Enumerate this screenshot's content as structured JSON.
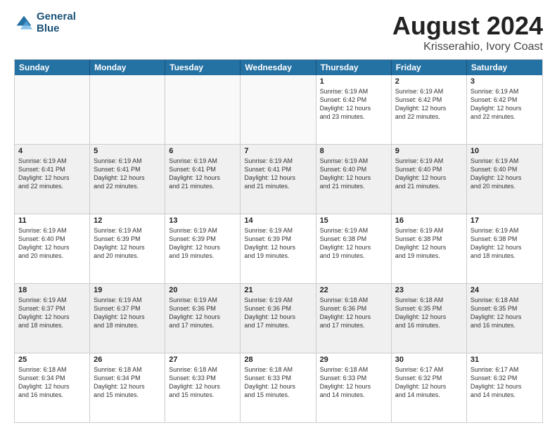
{
  "header": {
    "logo_line1": "General",
    "logo_line2": "Blue",
    "main_title": "August 2024",
    "subtitle": "Krisserahio, Ivory Coast"
  },
  "days_of_week": [
    "Sunday",
    "Monday",
    "Tuesday",
    "Wednesday",
    "Thursday",
    "Friday",
    "Saturday"
  ],
  "weeks": [
    [
      {
        "day": "",
        "info": "",
        "empty": true
      },
      {
        "day": "",
        "info": "",
        "empty": true
      },
      {
        "day": "",
        "info": "",
        "empty": true
      },
      {
        "day": "",
        "info": "",
        "empty": true
      },
      {
        "day": "1",
        "info": "Sunrise: 6:19 AM\nSunset: 6:42 PM\nDaylight: 12 hours\nand 23 minutes."
      },
      {
        "day": "2",
        "info": "Sunrise: 6:19 AM\nSunset: 6:42 PM\nDaylight: 12 hours\nand 22 minutes."
      },
      {
        "day": "3",
        "info": "Sunrise: 6:19 AM\nSunset: 6:42 PM\nDaylight: 12 hours\nand 22 minutes."
      }
    ],
    [
      {
        "day": "4",
        "info": "Sunrise: 6:19 AM\nSunset: 6:41 PM\nDaylight: 12 hours\nand 22 minutes.",
        "shaded": true
      },
      {
        "day": "5",
        "info": "Sunrise: 6:19 AM\nSunset: 6:41 PM\nDaylight: 12 hours\nand 22 minutes.",
        "shaded": true
      },
      {
        "day": "6",
        "info": "Sunrise: 6:19 AM\nSunset: 6:41 PM\nDaylight: 12 hours\nand 21 minutes.",
        "shaded": true
      },
      {
        "day": "7",
        "info": "Sunrise: 6:19 AM\nSunset: 6:41 PM\nDaylight: 12 hours\nand 21 minutes.",
        "shaded": true
      },
      {
        "day": "8",
        "info": "Sunrise: 6:19 AM\nSunset: 6:40 PM\nDaylight: 12 hours\nand 21 minutes.",
        "shaded": true
      },
      {
        "day": "9",
        "info": "Sunrise: 6:19 AM\nSunset: 6:40 PM\nDaylight: 12 hours\nand 21 minutes.",
        "shaded": true
      },
      {
        "day": "10",
        "info": "Sunrise: 6:19 AM\nSunset: 6:40 PM\nDaylight: 12 hours\nand 20 minutes.",
        "shaded": true
      }
    ],
    [
      {
        "day": "11",
        "info": "Sunrise: 6:19 AM\nSunset: 6:40 PM\nDaylight: 12 hours\nand 20 minutes."
      },
      {
        "day": "12",
        "info": "Sunrise: 6:19 AM\nSunset: 6:39 PM\nDaylight: 12 hours\nand 20 minutes."
      },
      {
        "day": "13",
        "info": "Sunrise: 6:19 AM\nSunset: 6:39 PM\nDaylight: 12 hours\nand 19 minutes."
      },
      {
        "day": "14",
        "info": "Sunrise: 6:19 AM\nSunset: 6:39 PM\nDaylight: 12 hours\nand 19 minutes."
      },
      {
        "day": "15",
        "info": "Sunrise: 6:19 AM\nSunset: 6:38 PM\nDaylight: 12 hours\nand 19 minutes."
      },
      {
        "day": "16",
        "info": "Sunrise: 6:19 AM\nSunset: 6:38 PM\nDaylight: 12 hours\nand 19 minutes."
      },
      {
        "day": "17",
        "info": "Sunrise: 6:19 AM\nSunset: 6:38 PM\nDaylight: 12 hours\nand 18 minutes."
      }
    ],
    [
      {
        "day": "18",
        "info": "Sunrise: 6:19 AM\nSunset: 6:37 PM\nDaylight: 12 hours\nand 18 minutes.",
        "shaded": true
      },
      {
        "day": "19",
        "info": "Sunrise: 6:19 AM\nSunset: 6:37 PM\nDaylight: 12 hours\nand 18 minutes.",
        "shaded": true
      },
      {
        "day": "20",
        "info": "Sunrise: 6:19 AM\nSunset: 6:36 PM\nDaylight: 12 hours\nand 17 minutes.",
        "shaded": true
      },
      {
        "day": "21",
        "info": "Sunrise: 6:19 AM\nSunset: 6:36 PM\nDaylight: 12 hours\nand 17 minutes.",
        "shaded": true
      },
      {
        "day": "22",
        "info": "Sunrise: 6:18 AM\nSunset: 6:36 PM\nDaylight: 12 hours\nand 17 minutes.",
        "shaded": true
      },
      {
        "day": "23",
        "info": "Sunrise: 6:18 AM\nSunset: 6:35 PM\nDaylight: 12 hours\nand 16 minutes.",
        "shaded": true
      },
      {
        "day": "24",
        "info": "Sunrise: 6:18 AM\nSunset: 6:35 PM\nDaylight: 12 hours\nand 16 minutes.",
        "shaded": true
      }
    ],
    [
      {
        "day": "25",
        "info": "Sunrise: 6:18 AM\nSunset: 6:34 PM\nDaylight: 12 hours\nand 16 minutes."
      },
      {
        "day": "26",
        "info": "Sunrise: 6:18 AM\nSunset: 6:34 PM\nDaylight: 12 hours\nand 15 minutes."
      },
      {
        "day": "27",
        "info": "Sunrise: 6:18 AM\nSunset: 6:33 PM\nDaylight: 12 hours\nand 15 minutes."
      },
      {
        "day": "28",
        "info": "Sunrise: 6:18 AM\nSunset: 6:33 PM\nDaylight: 12 hours\nand 15 minutes."
      },
      {
        "day": "29",
        "info": "Sunrise: 6:18 AM\nSunset: 6:33 PM\nDaylight: 12 hours\nand 14 minutes."
      },
      {
        "day": "30",
        "info": "Sunrise: 6:17 AM\nSunset: 6:32 PM\nDaylight: 12 hours\nand 14 minutes."
      },
      {
        "day": "31",
        "info": "Sunrise: 6:17 AM\nSunset: 6:32 PM\nDaylight: 12 hours\nand 14 minutes."
      }
    ]
  ]
}
